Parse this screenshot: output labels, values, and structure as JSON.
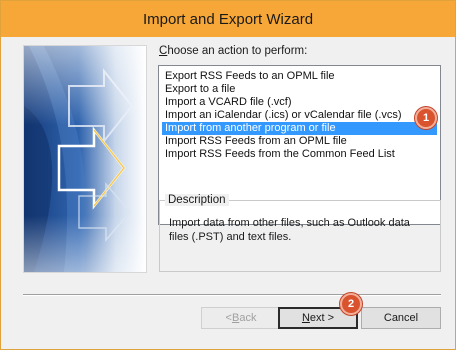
{
  "window": {
    "title": "Import and Export Wizard"
  },
  "prompt": {
    "mnemonic": "C",
    "rest": "hoose an action to perform:"
  },
  "actions": [
    "Export RSS Feeds to an OPML file",
    "Export to a file",
    "Import a VCARD file (.vcf)",
    "Import an iCalendar (.ics) or vCalendar file (.vcs)",
    "Import from another program or file",
    "Import RSS Feeds from an OPML file",
    "Import RSS Feeds from the Common Feed List"
  ],
  "selected_action": "Import from another program or file",
  "description": {
    "legend": "Description",
    "text": "Import data from other files, such as Outlook data files (.PST) and text files."
  },
  "buttons": {
    "back_arrow": "< ",
    "back_mnemonic": "B",
    "back_rest": "ack",
    "next_mnemonic": "N",
    "next_rest": "ext >",
    "cancel": "Cancel"
  },
  "callouts": {
    "one": "1",
    "two": "2"
  },
  "colors": {
    "title_bar": "#f7a738",
    "selection": "#3399ff",
    "callout": "#d9532f",
    "banner_blue": "#2f63ad"
  }
}
